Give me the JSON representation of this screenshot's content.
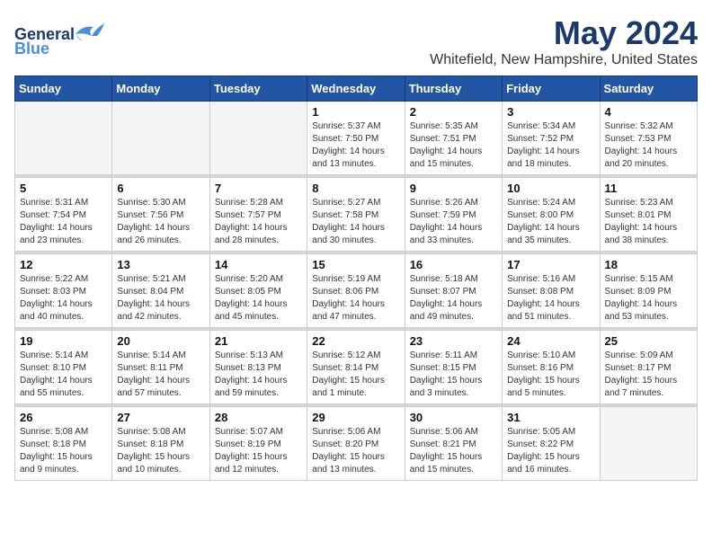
{
  "header": {
    "logo_general": "General",
    "logo_blue": "Blue",
    "month": "May 2024",
    "location": "Whitefield, New Hampshire, United States"
  },
  "weekdays": [
    "Sunday",
    "Monday",
    "Tuesday",
    "Wednesday",
    "Thursday",
    "Friday",
    "Saturday"
  ],
  "weeks": [
    [
      {
        "day": "",
        "sunrise": "",
        "sunset": "",
        "daylight": "",
        "empty": true
      },
      {
        "day": "",
        "sunrise": "",
        "sunset": "",
        "daylight": "",
        "empty": true
      },
      {
        "day": "",
        "sunrise": "",
        "sunset": "",
        "daylight": "",
        "empty": true
      },
      {
        "day": "1",
        "sunrise": "Sunrise: 5:37 AM",
        "sunset": "Sunset: 7:50 PM",
        "daylight": "Daylight: 14 hours and 13 minutes."
      },
      {
        "day": "2",
        "sunrise": "Sunrise: 5:35 AM",
        "sunset": "Sunset: 7:51 PM",
        "daylight": "Daylight: 14 hours and 15 minutes."
      },
      {
        "day": "3",
        "sunrise": "Sunrise: 5:34 AM",
        "sunset": "Sunset: 7:52 PM",
        "daylight": "Daylight: 14 hours and 18 minutes."
      },
      {
        "day": "4",
        "sunrise": "Sunrise: 5:32 AM",
        "sunset": "Sunset: 7:53 PM",
        "daylight": "Daylight: 14 hours and 20 minutes."
      }
    ],
    [
      {
        "day": "5",
        "sunrise": "Sunrise: 5:31 AM",
        "sunset": "Sunset: 7:54 PM",
        "daylight": "Daylight: 14 hours and 23 minutes."
      },
      {
        "day": "6",
        "sunrise": "Sunrise: 5:30 AM",
        "sunset": "Sunset: 7:56 PM",
        "daylight": "Daylight: 14 hours and 26 minutes."
      },
      {
        "day": "7",
        "sunrise": "Sunrise: 5:28 AM",
        "sunset": "Sunset: 7:57 PM",
        "daylight": "Daylight: 14 hours and 28 minutes."
      },
      {
        "day": "8",
        "sunrise": "Sunrise: 5:27 AM",
        "sunset": "Sunset: 7:58 PM",
        "daylight": "Daylight: 14 hours and 30 minutes."
      },
      {
        "day": "9",
        "sunrise": "Sunrise: 5:26 AM",
        "sunset": "Sunset: 7:59 PM",
        "daylight": "Daylight: 14 hours and 33 minutes."
      },
      {
        "day": "10",
        "sunrise": "Sunrise: 5:24 AM",
        "sunset": "Sunset: 8:00 PM",
        "daylight": "Daylight: 14 hours and 35 minutes."
      },
      {
        "day": "11",
        "sunrise": "Sunrise: 5:23 AM",
        "sunset": "Sunset: 8:01 PM",
        "daylight": "Daylight: 14 hours and 38 minutes."
      }
    ],
    [
      {
        "day": "12",
        "sunrise": "Sunrise: 5:22 AM",
        "sunset": "Sunset: 8:03 PM",
        "daylight": "Daylight: 14 hours and 40 minutes."
      },
      {
        "day": "13",
        "sunrise": "Sunrise: 5:21 AM",
        "sunset": "Sunset: 8:04 PM",
        "daylight": "Daylight: 14 hours and 42 minutes."
      },
      {
        "day": "14",
        "sunrise": "Sunrise: 5:20 AM",
        "sunset": "Sunset: 8:05 PM",
        "daylight": "Daylight: 14 hours and 45 minutes."
      },
      {
        "day": "15",
        "sunrise": "Sunrise: 5:19 AM",
        "sunset": "Sunset: 8:06 PM",
        "daylight": "Daylight: 14 hours and 47 minutes."
      },
      {
        "day": "16",
        "sunrise": "Sunrise: 5:18 AM",
        "sunset": "Sunset: 8:07 PM",
        "daylight": "Daylight: 14 hours and 49 minutes."
      },
      {
        "day": "17",
        "sunrise": "Sunrise: 5:16 AM",
        "sunset": "Sunset: 8:08 PM",
        "daylight": "Daylight: 14 hours and 51 minutes."
      },
      {
        "day": "18",
        "sunrise": "Sunrise: 5:15 AM",
        "sunset": "Sunset: 8:09 PM",
        "daylight": "Daylight: 14 hours and 53 minutes."
      }
    ],
    [
      {
        "day": "19",
        "sunrise": "Sunrise: 5:14 AM",
        "sunset": "Sunset: 8:10 PM",
        "daylight": "Daylight: 14 hours and 55 minutes."
      },
      {
        "day": "20",
        "sunrise": "Sunrise: 5:14 AM",
        "sunset": "Sunset: 8:11 PM",
        "daylight": "Daylight: 14 hours and 57 minutes."
      },
      {
        "day": "21",
        "sunrise": "Sunrise: 5:13 AM",
        "sunset": "Sunset: 8:13 PM",
        "daylight": "Daylight: 14 hours and 59 minutes."
      },
      {
        "day": "22",
        "sunrise": "Sunrise: 5:12 AM",
        "sunset": "Sunset: 8:14 PM",
        "daylight": "Daylight: 15 hours and 1 minute."
      },
      {
        "day": "23",
        "sunrise": "Sunrise: 5:11 AM",
        "sunset": "Sunset: 8:15 PM",
        "daylight": "Daylight: 15 hours and 3 minutes."
      },
      {
        "day": "24",
        "sunrise": "Sunrise: 5:10 AM",
        "sunset": "Sunset: 8:16 PM",
        "daylight": "Daylight: 15 hours and 5 minutes."
      },
      {
        "day": "25",
        "sunrise": "Sunrise: 5:09 AM",
        "sunset": "Sunset: 8:17 PM",
        "daylight": "Daylight: 15 hours and 7 minutes."
      }
    ],
    [
      {
        "day": "26",
        "sunrise": "Sunrise: 5:08 AM",
        "sunset": "Sunset: 8:18 PM",
        "daylight": "Daylight: 15 hours and 9 minutes."
      },
      {
        "day": "27",
        "sunrise": "Sunrise: 5:08 AM",
        "sunset": "Sunset: 8:18 PM",
        "daylight": "Daylight: 15 hours and 10 minutes."
      },
      {
        "day": "28",
        "sunrise": "Sunrise: 5:07 AM",
        "sunset": "Sunset: 8:19 PM",
        "daylight": "Daylight: 15 hours and 12 minutes."
      },
      {
        "day": "29",
        "sunrise": "Sunrise: 5:06 AM",
        "sunset": "Sunset: 8:20 PM",
        "daylight": "Daylight: 15 hours and 13 minutes."
      },
      {
        "day": "30",
        "sunrise": "Sunrise: 5:06 AM",
        "sunset": "Sunset: 8:21 PM",
        "daylight": "Daylight: 15 hours and 15 minutes."
      },
      {
        "day": "31",
        "sunrise": "Sunrise: 5:05 AM",
        "sunset": "Sunset: 8:22 PM",
        "daylight": "Daylight: 15 hours and 16 minutes."
      },
      {
        "day": "",
        "sunrise": "",
        "sunset": "",
        "daylight": "",
        "empty": true
      }
    ]
  ]
}
